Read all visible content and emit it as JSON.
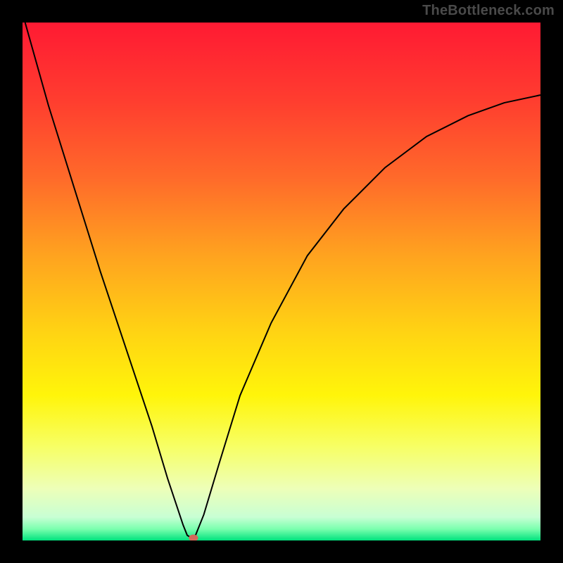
{
  "watermark": "TheBottleneck.com",
  "chart_data": {
    "type": "line",
    "title": "",
    "xlabel": "",
    "ylabel": "",
    "xlim": [
      0,
      100
    ],
    "ylim": [
      0,
      100
    ],
    "grid": false,
    "legend": false,
    "background": {
      "type": "vertical-gradient",
      "stops": [
        {
          "pos": 0.0,
          "color": "#ff1a33"
        },
        {
          "pos": 0.15,
          "color": "#ff3d2f"
        },
        {
          "pos": 0.3,
          "color": "#ff6a2a"
        },
        {
          "pos": 0.45,
          "color": "#ffa31f"
        },
        {
          "pos": 0.6,
          "color": "#ffd413"
        },
        {
          "pos": 0.72,
          "color": "#fff50a"
        },
        {
          "pos": 0.82,
          "color": "#f7ff66"
        },
        {
          "pos": 0.9,
          "color": "#edffb8"
        },
        {
          "pos": 0.955,
          "color": "#c8ffd4"
        },
        {
          "pos": 0.978,
          "color": "#7affae"
        },
        {
          "pos": 1.0,
          "color": "#00e27d"
        }
      ]
    },
    "series": [
      {
        "name": "bottleneck-curve",
        "color": "#000000",
        "x": [
          0.5,
          5,
          10,
          15,
          20,
          25,
          28,
          30,
          31,
          31.8,
          32.6,
          33.2,
          35,
          38,
          42,
          48,
          55,
          62,
          70,
          78,
          86,
          93,
          100
        ],
        "y": [
          100,
          84,
          68,
          52,
          37,
          22,
          12,
          6,
          3,
          1,
          0.5,
          0.5,
          5,
          15,
          28,
          42,
          55,
          64,
          72,
          78,
          82,
          84.5,
          86
        ]
      }
    ],
    "marker": {
      "name": "optimal-point",
      "x": 33,
      "y": 0.5,
      "color": "#d46a5a",
      "rx": 0.9,
      "ry": 0.65
    }
  }
}
